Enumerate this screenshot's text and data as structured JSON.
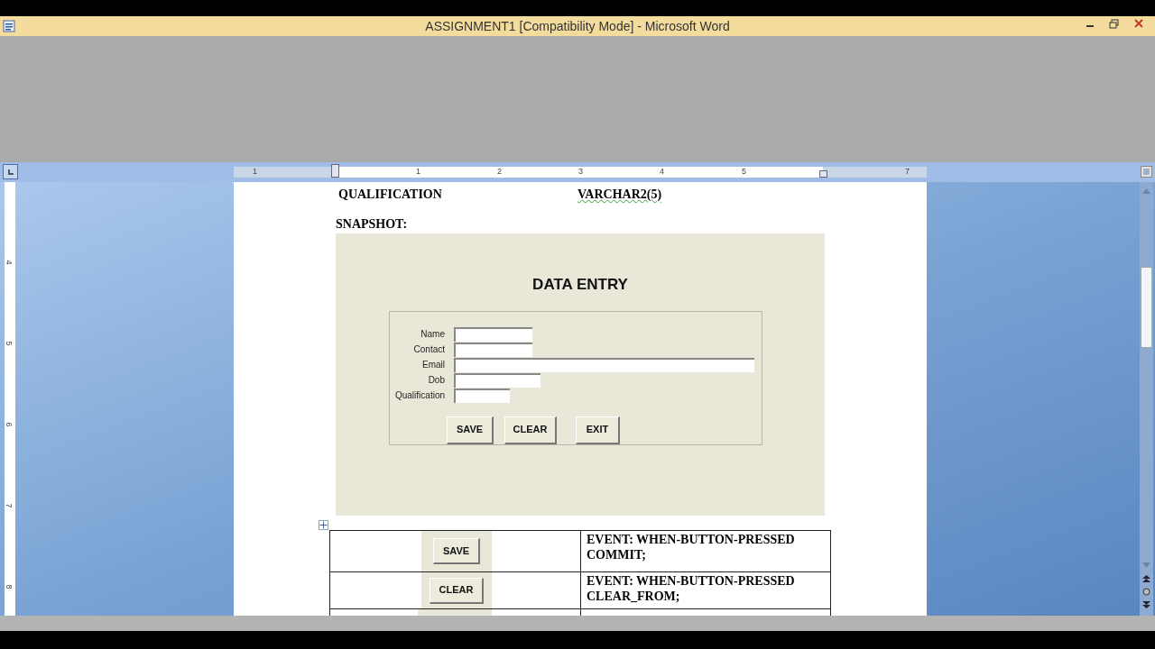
{
  "window": {
    "title": "ASSIGNMENT1 [Compatibility Mode] - Microsoft Word"
  },
  "ruler": {
    "horizontal_labels": [
      "1",
      "1",
      "2",
      "3",
      "4",
      "5",
      "7"
    ],
    "vertical_labels": [
      "4",
      "5",
      "6",
      "7",
      "8"
    ]
  },
  "document": {
    "field_row": {
      "name": "QUALIFICATION",
      "type": "VARCHAR2(5)"
    },
    "heading": "SNAPSHOT:",
    "snapshot": {
      "title": "DATA ENTRY",
      "fields": [
        {
          "label": "Name"
        },
        {
          "label": "Contact"
        },
        {
          "label": "Email"
        },
        {
          "label": "Dob"
        },
        {
          "label": "Qualification"
        }
      ],
      "buttons": [
        "SAVE",
        "CLEAR",
        "EXIT"
      ]
    },
    "trigger_table": {
      "rows": [
        {
          "button": "SAVE",
          "code": "EVENT: WHEN-BUTTON-PRESSED\nCOMMIT;"
        },
        {
          "button": "CLEAR",
          "code": "EVENT: WHEN-BUTTON-PRESSED\nCLEAR_FROM;"
        }
      ],
      "more_rows_below": true
    }
  }
}
